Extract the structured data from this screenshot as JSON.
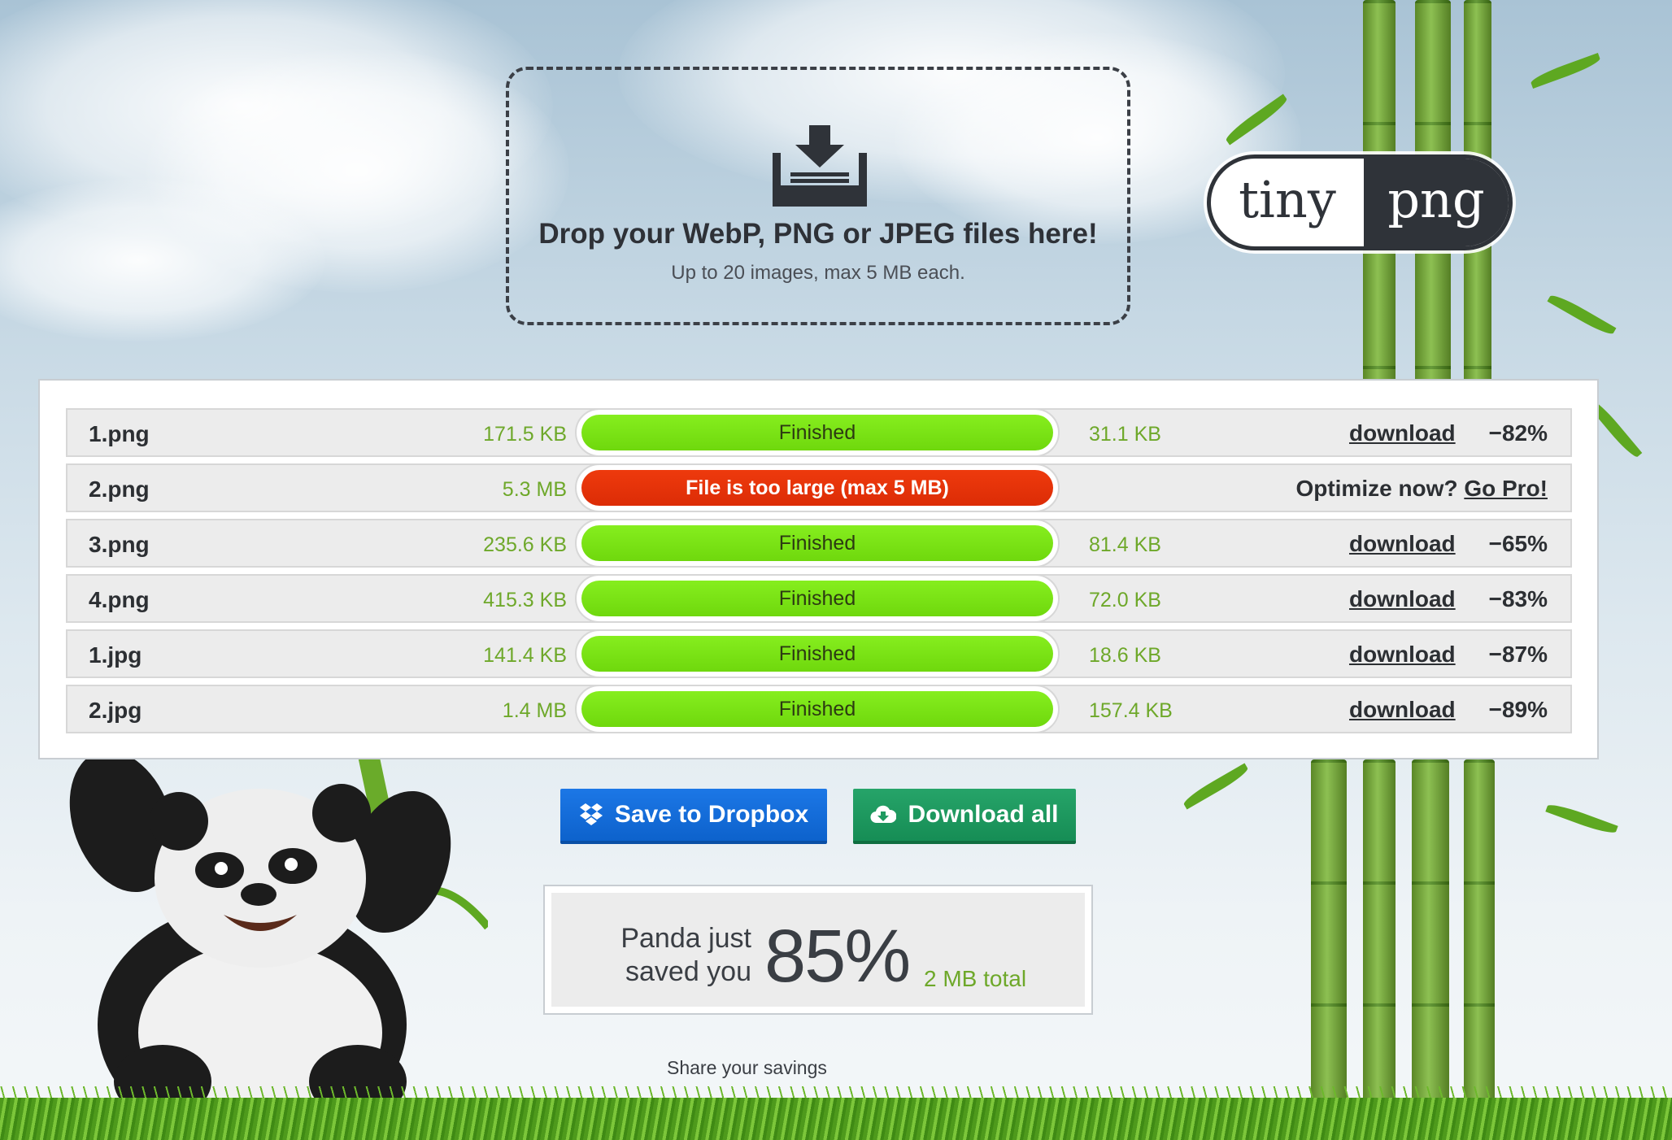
{
  "dropzone": {
    "title": "Drop your WebP, PNG or JPEG files here!",
    "subtitle": "Up to 20 images, max 5 MB each."
  },
  "logo": {
    "left": "tiny",
    "right": "png"
  },
  "files": [
    {
      "name": "1.png",
      "size": "171.5 KB",
      "status": "Finished",
      "status_type": "ok",
      "out_size": "31.1 KB",
      "download_label": "download",
      "savings": "−82%"
    },
    {
      "name": "2.png",
      "size": "5.3 MB",
      "status": "File is too large (max 5 MB)",
      "status_type": "error",
      "optimize_text": "Optimize now?",
      "go_pro_label": "Go Pro!"
    },
    {
      "name": "3.png",
      "size": "235.6 KB",
      "status": "Finished",
      "status_type": "ok",
      "out_size": "81.4 KB",
      "download_label": "download",
      "savings": "−65%"
    },
    {
      "name": "4.png",
      "size": "415.3 KB",
      "status": "Finished",
      "status_type": "ok",
      "out_size": "72.0 KB",
      "download_label": "download",
      "savings": "−83%"
    },
    {
      "name": "1.jpg",
      "size": "141.4 KB",
      "status": "Finished",
      "status_type": "ok",
      "out_size": "18.6 KB",
      "download_label": "download",
      "savings": "−87%"
    },
    {
      "name": "2.jpg",
      "size": "1.4 MB",
      "status": "Finished",
      "status_type": "ok",
      "out_size": "157.4 KB",
      "download_label": "download",
      "savings": "−89%"
    }
  ],
  "actions": {
    "dropbox_label": "Save to Dropbox",
    "download_all_label": "Download all"
  },
  "savings": {
    "line1": "Panda just",
    "line2": "saved you",
    "percent": "85%",
    "total": "2 MB total"
  },
  "share_label": "Share your savings",
  "colors": {
    "finished_bar": "#7ce416",
    "error_bar": "#e8340a",
    "size_text": "#6ea82a",
    "dropbox_button": "#1570dc",
    "download_button": "#1f9a60"
  },
  "icons": {
    "dropzone": "download-tray-icon",
    "dropbox": "dropbox-icon",
    "download_all": "cloud-download-icon"
  }
}
